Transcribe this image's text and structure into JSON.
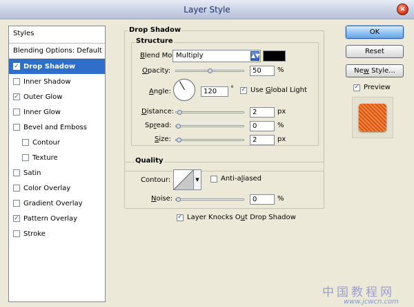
{
  "window": {
    "title": "Layer Style",
    "close_glyph": "×"
  },
  "styles": {
    "header": "Styles",
    "blending": "Blending Options: Default",
    "items": [
      {
        "label": "Drop Shadow",
        "checked": true,
        "selected": true,
        "indent": false
      },
      {
        "label": "Inner Shadow",
        "checked": false,
        "selected": false,
        "indent": false
      },
      {
        "label": "Outer Glow",
        "checked": true,
        "selected": false,
        "indent": false
      },
      {
        "label": "Inner Glow",
        "checked": false,
        "selected": false,
        "indent": false
      },
      {
        "label": "Bevel and Emboss",
        "checked": false,
        "selected": false,
        "indent": false
      },
      {
        "label": "Contour",
        "checked": false,
        "selected": false,
        "indent": true
      },
      {
        "label": "Texture",
        "checked": false,
        "selected": false,
        "indent": true
      },
      {
        "label": "Satin",
        "checked": false,
        "selected": false,
        "indent": false
      },
      {
        "label": "Color Overlay",
        "checked": false,
        "selected": false,
        "indent": false
      },
      {
        "label": "Gradient Overlay",
        "checked": false,
        "selected": false,
        "indent": false
      },
      {
        "label": "Pattern Overlay",
        "checked": true,
        "selected": false,
        "indent": false
      },
      {
        "label": "Stroke",
        "checked": false,
        "selected": false,
        "indent": false
      }
    ]
  },
  "drop_shadow": {
    "section_title": "Drop Shadow",
    "structure": {
      "title": "Structure",
      "blend_mode": {
        "label_pre": "",
        "label_key": "B",
        "label_post": "lend Mode:",
        "value": "Multiply",
        "color": "#000000"
      },
      "opacity": {
        "label_pre": "",
        "label_key": "O",
        "label_post": "pacity:",
        "value": "50",
        "unit": "%",
        "level": 0.5
      },
      "angle": {
        "label_pre": "",
        "label_key": "A",
        "label_post": "ngle:",
        "value": "120",
        "unit": "°"
      },
      "global_light": {
        "label_pre": "Use ",
        "label_key": "G",
        "label_post": "lobal Light",
        "checked": true
      },
      "distance": {
        "label_pre": "",
        "label_key": "D",
        "label_post": "istance:",
        "value": "2",
        "unit": "px",
        "level": 0.02
      },
      "spread": {
        "label_pre": "Sp",
        "label_key": "r",
        "label_post": "ead:",
        "value": "0",
        "unit": "%",
        "level": 0.0
      },
      "size": {
        "label_pre": "",
        "label_key": "S",
        "label_post": "ize:",
        "value": "2",
        "unit": "px",
        "level": 0.01
      }
    },
    "quality": {
      "title": "Quality",
      "contour_label": "Contour:",
      "antialiased": {
        "label_pre": "Anti-a",
        "label_key": "l",
        "label_post": "iased",
        "checked": false
      },
      "noise": {
        "label_pre": "",
        "label_key": "N",
        "label_post": "oise:",
        "value": "0",
        "unit": "%",
        "level": 0.0
      }
    },
    "knockout": {
      "label_pre": "Layer Knocks O",
      "label_key": "u",
      "label_post": "t Drop Shadow",
      "checked": true
    }
  },
  "buttons": {
    "ok": "OK",
    "reset": "Reset",
    "new_style_pre": "Ne",
    "new_style_key": "w",
    "new_style_post": " Style...",
    "preview_label": "Preview",
    "preview_checked": true
  },
  "watermark": {
    "line1": "中国教程网",
    "line2": "www.jcwcn.com"
  }
}
